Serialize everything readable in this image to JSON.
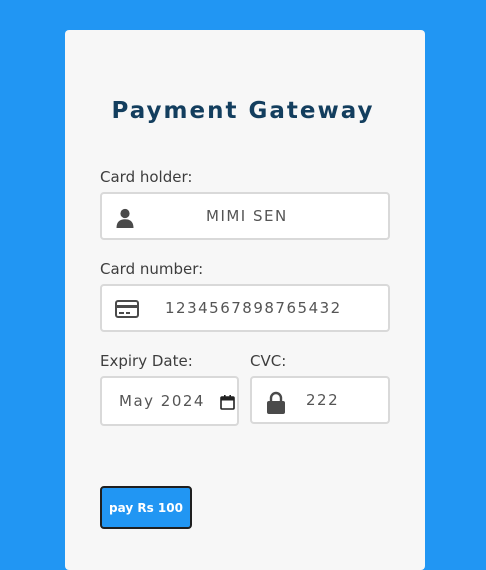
{
  "form": {
    "title": "Payment Gateway",
    "card_holder": {
      "label": "Card holder:",
      "value": "MIMI SEN",
      "icon": "user-icon"
    },
    "card_number": {
      "label": "Card number:",
      "value": "1234567898765432",
      "icon": "credit-card-icon"
    },
    "expiry": {
      "label": "Expiry Date:",
      "value": "May 2024",
      "icon": "calendar-icon"
    },
    "cvc": {
      "label": "CVC:",
      "value": "222",
      "icon": "lock-icon"
    },
    "pay_button": "pay Rs 100"
  },
  "colors": {
    "background": "#2196f3",
    "card": "#f7f7f7",
    "title": "#133e5e",
    "button": "#2196f3"
  }
}
